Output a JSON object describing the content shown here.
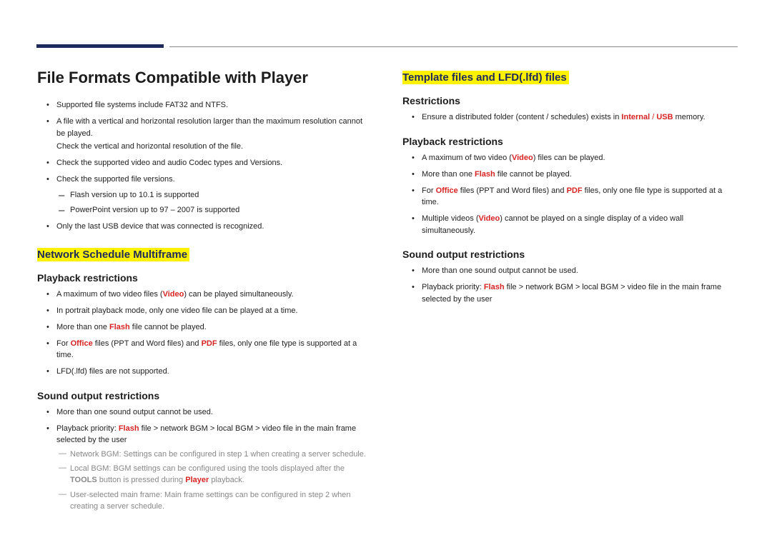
{
  "title": "File Formats Compatible with Player",
  "left": {
    "intro": [
      {
        "text": "Supported file systems include FAT32 and NTFS."
      },
      {
        "parts": [
          [
            "A file with a vertical and horizontal resolution larger than the maximum resolution cannot be played."
          ],
          [
            "cont",
            "Check the vertical and horizontal resolution of the file."
          ]
        ]
      },
      {
        "text": "Check the supported video and audio Codec types and Versions."
      },
      {
        "parts": [
          [
            "Check the supported file versions."
          ]
        ],
        "sub": [
          "Flash version up to 10.1 is supported",
          "PowerPoint version up to 97 – 2007 is supported"
        ]
      },
      {
        "text": "Only the last USB device that was connected is recognized."
      }
    ],
    "h2": "Network Schedule Multiframe",
    "playback": {
      "heading": "Playback restrictions",
      "items": [
        [
          [
            "",
            "A maximum of two video files ("
          ],
          [
            "red",
            "Video"
          ],
          [
            "",
            ") can be played simultaneously."
          ]
        ],
        [
          [
            "",
            "In portrait playback mode, only one video file can be played at a time."
          ]
        ],
        [
          [
            "",
            "More than one "
          ],
          [
            "red",
            "Flash"
          ],
          [
            "",
            " file cannot be played."
          ]
        ],
        [
          [
            "",
            "For "
          ],
          [
            "red",
            "Office"
          ],
          [
            "",
            " files (PPT and Word files) and "
          ],
          [
            "red",
            "PDF"
          ],
          [
            "",
            " files, only one file type is supported at a time."
          ]
        ],
        [
          [
            "",
            "LFD(.lfd) files are not supported."
          ]
        ]
      ]
    },
    "sound": {
      "heading": "Sound output restrictions",
      "items": [
        [
          [
            "",
            "More than one sound output cannot be used."
          ]
        ],
        [
          [
            "",
            "Playback priority: "
          ],
          [
            "red",
            "Flash"
          ],
          [
            "",
            " file > network BGM > local BGM > video file in the main frame selected by the user"
          ]
        ]
      ],
      "notes": [
        [
          [
            "",
            "Network BGM: Settings can be configured in step 1 when creating a server schedule."
          ]
        ],
        [
          [
            "",
            "Local BGM: BGM settings can be configured using the tools displayed after the "
          ],
          [
            "gbold",
            "TOOLS"
          ],
          [
            "",
            " button is pressed during "
          ],
          [
            "red",
            "Player"
          ],
          [
            "",
            " playback."
          ]
        ],
        [
          [
            "",
            "User-selected main frame: Main frame settings can be configured in step 2 when creating a server schedule."
          ]
        ]
      ]
    }
  },
  "right": {
    "h2": "Template files and LFD(.lfd) files",
    "restrictions": {
      "heading": "Restrictions",
      "items": [
        [
          [
            "",
            "Ensure a distributed folder (content / schedules) exists in "
          ],
          [
            "red",
            "Internal"
          ],
          [
            "",
            ""
          ],
          [
            "slash",
            " / "
          ],
          [
            "red",
            "USB"
          ],
          [
            "",
            " memory."
          ]
        ]
      ]
    },
    "playback": {
      "heading": "Playback restrictions",
      "items": [
        [
          [
            "",
            "A maximum of two video ("
          ],
          [
            "red",
            "Video"
          ],
          [
            "",
            ") files can be played."
          ]
        ],
        [
          [
            "",
            "More than one "
          ],
          [
            "red",
            "Flash"
          ],
          [
            "",
            " file cannot be played."
          ]
        ],
        [
          [
            "",
            "For "
          ],
          [
            "red",
            "Office"
          ],
          [
            "",
            " files (PPT and Word files) and "
          ],
          [
            "red",
            "PDF"
          ],
          [
            "",
            " files, only one file type is supported at a time."
          ]
        ],
        [
          [
            "",
            "Multiple videos ("
          ],
          [
            "red",
            "Video"
          ],
          [
            "",
            ") cannot be played on a single display of a video wall simultaneously."
          ]
        ]
      ]
    },
    "sound": {
      "heading": "Sound output restrictions",
      "items": [
        [
          [
            "",
            "More than one sound output cannot be used."
          ]
        ],
        [
          [
            "",
            "Playback priority: "
          ],
          [
            "red",
            "Flash"
          ],
          [
            "",
            " file > network BGM > local BGM > video file in the main frame selected by the user"
          ]
        ]
      ]
    }
  }
}
